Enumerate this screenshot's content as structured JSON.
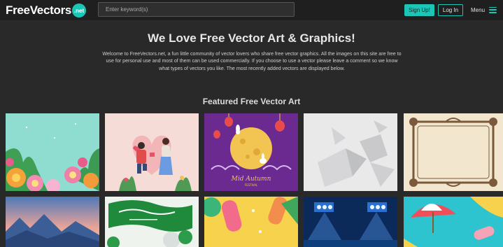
{
  "header": {
    "logo_main": "FreeVectors",
    "logo_badge": ".net",
    "search_placeholder": "Enter keyword(s)",
    "signup_label": "Sign Up!",
    "login_label": "Log In",
    "menu_label": "Menu"
  },
  "hero": {
    "title": "We Love Free Vector Art & Graphics!",
    "text": "Welcome to FreeVectors.net, a fun little community of vector lovers who share free vector graphics. All the images on this site are free to use for personal use and most of them can be used commercially. If you choose to use a vector please leave a comment so we know what types of vectors you like. The most recently added vectors are displayed below."
  },
  "featured": {
    "title": "Featured Free Vector Art",
    "cards": [
      {
        "name": "floral-corner-vector"
      },
      {
        "name": "valentine-couple-vector"
      },
      {
        "name": "mid-autumn-festival-vector",
        "caption_line1": "Mid Autumn",
        "caption_line2": "FESTIVAL"
      },
      {
        "name": "white-polygon-background-vector"
      },
      {
        "name": "ornamental-frame-vector"
      },
      {
        "name": "mountain-sunset-vector"
      },
      {
        "name": "saudi-flag-balloons-vector"
      },
      {
        "name": "summer-popsicle-vector"
      },
      {
        "name": "stadium-lights-vector"
      },
      {
        "name": "beach-umbrella-pool-vector"
      }
    ]
  },
  "colors": {
    "accent": "#1cc6b6",
    "background": "#292929",
    "header": "#1f1f1f"
  }
}
